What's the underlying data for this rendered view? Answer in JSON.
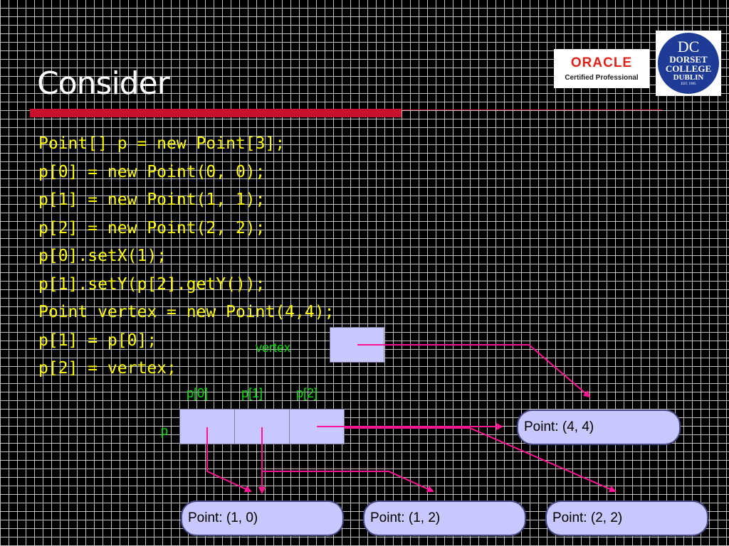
{
  "slide": {
    "title": "Consider",
    "accent_color": "#c8102e"
  },
  "logos": {
    "oracle": {
      "brand": "ORACLE",
      "subtitle": "Certified Professional"
    },
    "dorset": {
      "mark": "DC",
      "line1": "DORSET",
      "line2": "COLLEGE",
      "line3": "DUBLIN",
      "line4": "EST. 1985"
    }
  },
  "code_lines": [
    "Point[] p = new Point[3];",
    "p[0] = new Point(0, 0);",
    "p[1] = new Point(1, 1);",
    "p[2] = new Point(2, 2);",
    "p[0].setX(1);",
    "p[1].setY(p[2].getY());",
    "Point vertex = new Point(4,4);",
    "p[1] = p[0];",
    "p[2] = vertex;"
  ],
  "diagram": {
    "vertex_label": "vertex",
    "array_label": "p",
    "index_labels": [
      "p[0]",
      "p[1]",
      "p[2]"
    ],
    "points": {
      "vertex_point": "Point: (4, 4)",
      "point_a": "Point: (1, 0)",
      "point_b": "Point: (1, 2)",
      "point_c": "Point: (2, 2)"
    },
    "arrow_color": "#ff1493",
    "label_color": "#00dd00",
    "code_color": "#ffff00"
  }
}
